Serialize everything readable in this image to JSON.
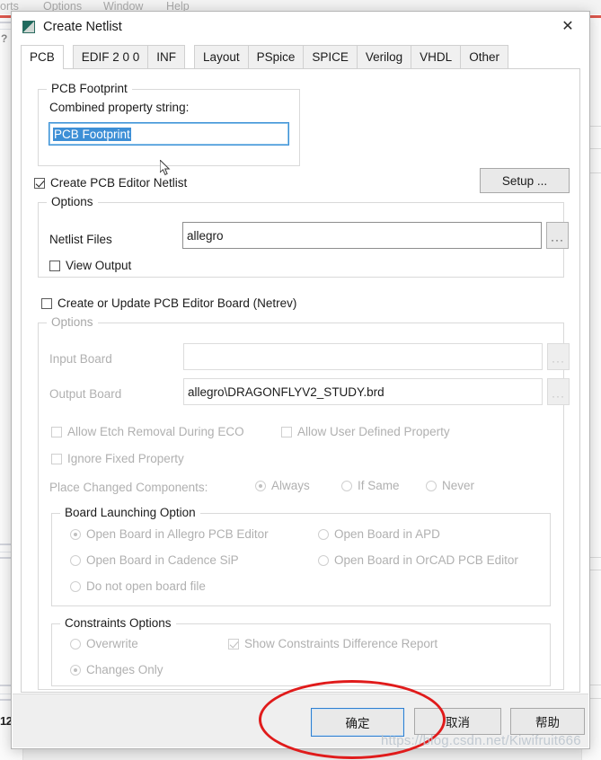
{
  "background": {
    "menu_items": [
      "orts",
      "Options",
      "Window",
      "Help"
    ],
    "left_marker": "12",
    "help_glyph": "?"
  },
  "dialog": {
    "title": "Create Netlist",
    "title_icon": "netlist-app-icon",
    "close_label": "✕",
    "tabs": [
      {
        "label": "PCB",
        "active": true
      },
      {
        "label": "EDIF 2 0 0",
        "active": false
      },
      {
        "label": "INF",
        "active": false
      },
      {
        "label": "Layout",
        "active": false
      },
      {
        "label": "PSpice",
        "active": false
      },
      {
        "label": "SPICE",
        "active": false
      },
      {
        "label": "Verilog",
        "active": false
      },
      {
        "label": "VHDL",
        "active": false
      },
      {
        "label": "Other",
        "active": false
      }
    ],
    "pcb_footprint": {
      "legend": "PCB Footprint",
      "combined_label": "Combined property string:",
      "combined_value": "PCB Footprint",
      "combined_selected": true
    },
    "create_netlist": {
      "checkbox_label": "Create PCB Editor Netlist",
      "checked": true,
      "setup_button": "Setup ...",
      "options_legend": "Options",
      "netlist_files_label": "Netlist Files",
      "netlist_files_value": "allegro",
      "browse_label": "···",
      "view_output_label": "View Output",
      "view_output_checked": false
    },
    "netrev": {
      "checkbox_label": "Create or Update PCB Editor Board (Netrev)",
      "checked": false,
      "options_legend": "Options",
      "input_board_label": "Input Board",
      "input_board_value": "",
      "output_board_label": "Output Board",
      "output_board_value": "allegro\\DRAGONFLYV2_STUDY.brd",
      "browse_label": "···",
      "allow_etch_removal_label": "Allow Etch Removal During ECO",
      "allow_etch_removal_checked": false,
      "allow_user_defined_label": "Allow User Defined Property",
      "allow_user_defined_checked": false,
      "ignore_fixed_label": "Ignore Fixed Property",
      "ignore_fixed_checked": false,
      "place_changed_label": "Place Changed Components:",
      "place_changed_options": [
        {
          "label": "Always",
          "selected": true
        },
        {
          "label": "If Same",
          "selected": false
        },
        {
          "label": "Never",
          "selected": false
        }
      ],
      "board_launching": {
        "legend": "Board Launching Option",
        "options": [
          {
            "label": "Open Board in Allegro PCB Editor",
            "selected": true
          },
          {
            "label": "Open Board in APD",
            "selected": false
          },
          {
            "label": "Open Board in Cadence SiP",
            "selected": false
          },
          {
            "label": "Open Board in OrCAD PCB Editor",
            "selected": false
          },
          {
            "label": "Do not open board file",
            "selected": false
          }
        ]
      },
      "constraints": {
        "legend": "Constraints Options",
        "options": [
          {
            "label": "Overwrite",
            "selected": false
          },
          {
            "label": "Changes  Only",
            "selected": true
          }
        ],
        "show_diff_label": "Show Constraints Difference Report",
        "show_diff_checked": true
      }
    },
    "footer": {
      "ok_label": "确定",
      "cancel_label": "取消",
      "help_label": "帮助"
    }
  },
  "annotations": {
    "highlight_ellipse": "red-ellipse-around-ok-button",
    "watermark": "https://blog.csdn.net/Kiwifruit666"
  },
  "colors": {
    "accent_blue": "#3d8fd6",
    "annotation_red": "#e01b1b",
    "dialog_bg": "#ffffff",
    "footer_bg": "#efefef"
  }
}
